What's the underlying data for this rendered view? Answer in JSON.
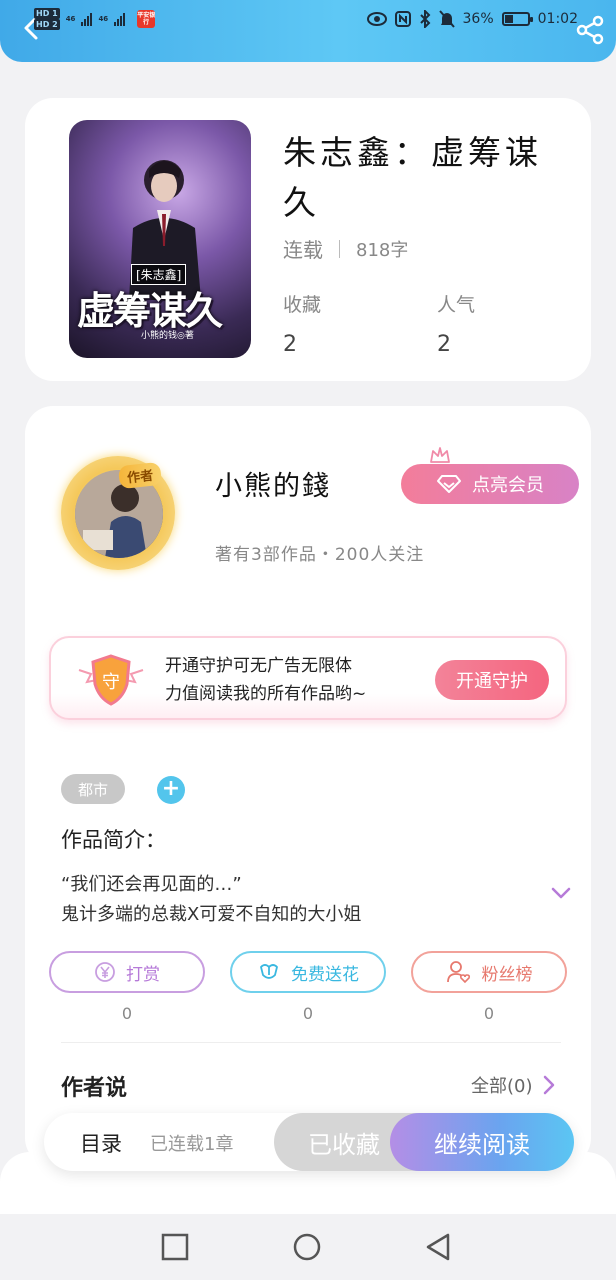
{
  "status_bar": {
    "sim1": "HD 1",
    "sim2": "HD 2",
    "net1": "46",
    "net2": "46",
    "battery": "36%",
    "time": "01:02",
    "app_badge": "平安银行"
  },
  "book": {
    "title": "朱志鑫：虚筹谋久",
    "status": "连载",
    "word_count": "818字",
    "favorites_label": "收藏",
    "favorites_value": "2",
    "popularity_label": "人气",
    "popularity_value": "2",
    "cover": {
      "subtitle": "[朱志鑫]",
      "title": "虚筹谋久",
      "author": "小熊的钱◎著"
    }
  },
  "author": {
    "tag": "作者",
    "name": "小熊的錢",
    "member_button": "点亮会员",
    "stats": "著有3部作品・200人关注"
  },
  "guard": {
    "shield_char": "守",
    "text_line1": "开通守护可无广告无限体",
    "text_line2": "力值阅读我的所有作品哟~",
    "button": "开通守护"
  },
  "tags": {
    "genre": "都市",
    "add": "+"
  },
  "intro": {
    "title": "作品简介：",
    "line1": "“我们还会再见面的…”",
    "line2": "鬼计多端的总裁X可爱不自知的大小姐"
  },
  "actions": {
    "reward": {
      "label": "打赏",
      "count": "0"
    },
    "flower": {
      "label": "免费送花",
      "count": "0"
    },
    "fans": {
      "label": "粉丝榜",
      "count": "0"
    }
  },
  "author_says": {
    "title": "作者说",
    "all": "全部(0)"
  },
  "read_bar": {
    "toc": "目录",
    "chapter_status": "已连载1章",
    "collected": "已收藏",
    "continue": "继续阅读"
  },
  "colors": {
    "header": "#4ab6ee",
    "member": "#f37d9a",
    "guard_button": "#f4657f",
    "continue_start": "#b48ee6",
    "continue_end": "#5bc6f3",
    "reward": "#b67ad8",
    "flower": "#3ab8e0",
    "fans": "#e7796e"
  }
}
